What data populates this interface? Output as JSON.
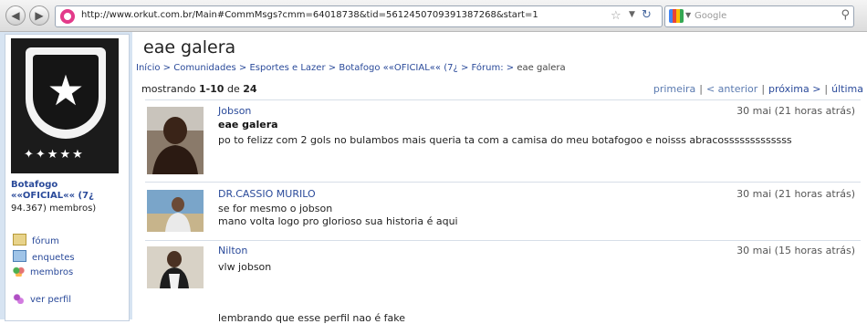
{
  "browser": {
    "url": "http://www.orkut.com.br/Main#CommMsgs?cmm=64018738&tid=5612450709391387268&start=1",
    "search_placeholder": "Google"
  },
  "community": {
    "name": "Botafogo",
    "tag": "««OFICIAL«« (7¿",
    "members": "94.367) membros)"
  },
  "sidebar_menu": [
    {
      "label": "fórum",
      "icon": "forum-icon"
    },
    {
      "label": "enquetes",
      "icon": "polls-icon"
    },
    {
      "label": "membros",
      "icon": "members-icon"
    },
    {
      "label": "ver perfil",
      "icon": "profile-icon"
    }
  ],
  "page": {
    "title": "eae galera",
    "breadcrumb": [
      "Início",
      "Comunidades",
      "Esportes e Lazer",
      "Botafogo ««OFICIAL«« (7¿",
      "Fórum:",
      "eae galera"
    ],
    "breadcrumb_sep": " > ",
    "count_prefix": "mostrando",
    "count_range": "1-10",
    "count_of": "de",
    "count_total": "24"
  },
  "pager": {
    "first": "primeira",
    "prev": "< anterior",
    "next": "próxima >",
    "last": "última",
    "sep": "|"
  },
  "posts": [
    {
      "author": "Jobson",
      "date": "30 mai (21 horas atrás)",
      "title": "eae galera",
      "lines": [
        "po to felizz com 2 gols no bulambos mais queria ta com a camisa do meu botafogoo e noisss abracosssssssssssss"
      ]
    },
    {
      "author": "DR.CASSIO MURILO",
      "date": "30 mai (21 horas atrás)",
      "title": "",
      "lines": [
        "se for mesmo o jobson",
        "mano volta logo pro glorioso sua historia é aqui"
      ]
    },
    {
      "author": "Nilton",
      "date": "30 mai (15 horas atrás)",
      "title": "",
      "lines": [
        "vlw jobson",
        "lembrando que esse perfil nao é fake"
      ]
    }
  ],
  "colors": {
    "link": "#2a4a9a",
    "sidebar_bg": "#d7e4f2"
  }
}
